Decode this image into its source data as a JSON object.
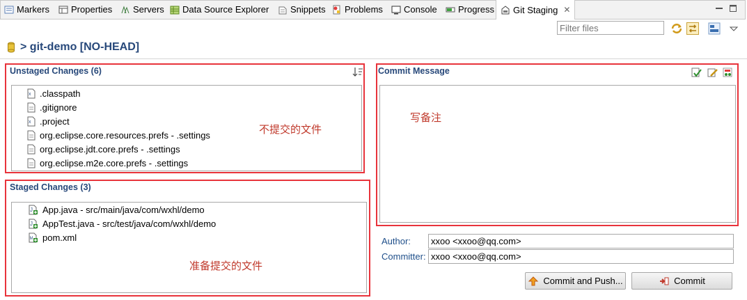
{
  "tabs": [
    {
      "label": "Markers",
      "icon": "markers-icon"
    },
    {
      "label": "Properties",
      "icon": "properties-icon"
    },
    {
      "label": "Servers",
      "icon": "servers-icon"
    },
    {
      "label": "Data Source Explorer",
      "icon": "data-source-icon"
    },
    {
      "label": "Snippets",
      "icon": "snippets-icon"
    },
    {
      "label": "Problems",
      "icon": "problems-icon"
    },
    {
      "label": "Console",
      "icon": "console-icon"
    },
    {
      "label": "Progress",
      "icon": "progress-icon"
    },
    {
      "label": "Git Staging",
      "icon": "git-staging-icon",
      "active": true
    }
  ],
  "toolbar": {
    "filter_placeholder": "Filter files"
  },
  "repo": {
    "title": "> git-demo [NO-HEAD]"
  },
  "unstaged": {
    "title": "Unstaged Changes (6)",
    "files": [
      ".classpath",
      ".gitignore",
      ".project",
      "org.eclipse.core.resources.prefs - .settings",
      "org.eclipse.jdt.core.prefs - .settings",
      "org.eclipse.m2e.core.prefs - .settings"
    ],
    "annotation": "不提交的文件"
  },
  "staged": {
    "title": "Staged Changes (3)",
    "files": [
      "App.java - src/main/java/com/wxhl/demo",
      "AppTest.java - src/test/java/com/wxhl/demo",
      "pom.xml"
    ],
    "annotation": "准备提交的文件"
  },
  "commit": {
    "title": "Commit Message",
    "annotation": "写备注",
    "author_label": "Author:",
    "author_value": "xxoo <xxoo@qq.com>",
    "committer_label": "Committer:",
    "committer_value": "xxoo <xxoo@qq.com>",
    "commit_push_label": "Commit and Push...",
    "commit_label": "Commit"
  },
  "colors": {
    "accent": "#27487a",
    "highlight": "#e8333b",
    "note": "#c0392b"
  }
}
